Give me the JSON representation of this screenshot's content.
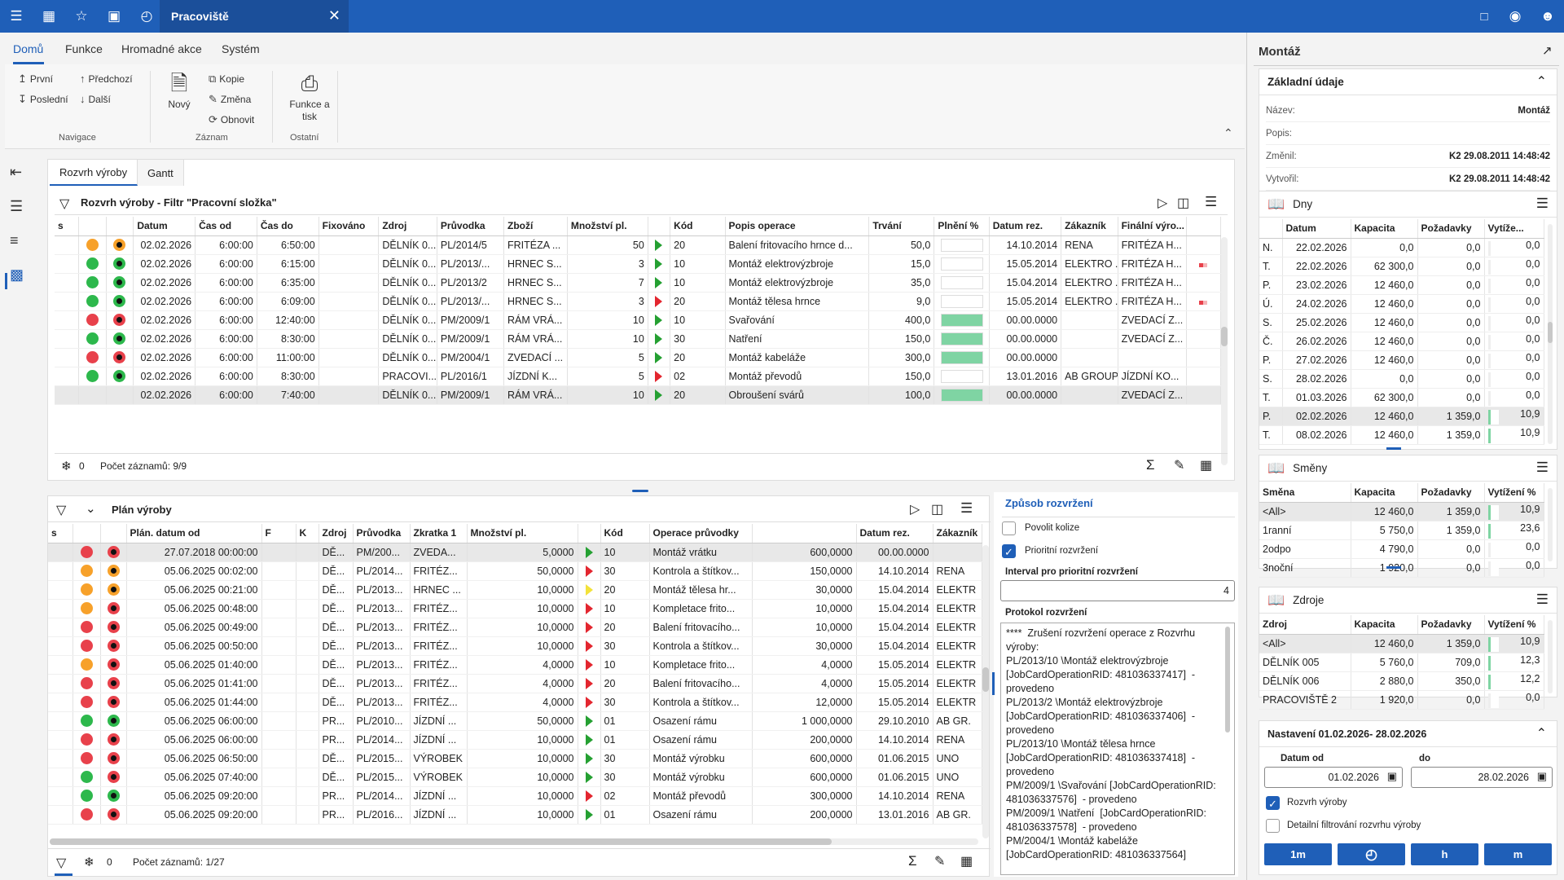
{
  "titlebar": {
    "tab_title": "Pracoviště"
  },
  "menu": [
    "Domů",
    "Funkce",
    "Hromadné akce",
    "Systém"
  ],
  "ribbon": {
    "nav": {
      "first": "První",
      "prev": "Předchozí",
      "last": "Poslední",
      "next": "Další",
      "group": "Navigace"
    },
    "record": {
      "new": "Nový",
      "copy": "Kopie",
      "change": "Změna",
      "refresh": "Obnovit",
      "group": "Záznam"
    },
    "other": {
      "print": "Funkce a tisk",
      "group": "Ostatní"
    }
  },
  "top_panel": {
    "tabs": [
      "Rozvrh výroby",
      "Gantt"
    ],
    "title": "Rozvrh výroby - Filtr \"Pracovní složka\"",
    "columns": [
      "s",
      "",
      "",
      "Datum",
      "Čas od",
      "Čas do",
      "Fixováno",
      "Zdroj",
      "Průvodka",
      "Zboží",
      "Množství pl.",
      "",
      "Kód",
      "Popis operace",
      "Trvání",
      "Plnění %",
      "Datum rez.",
      "Zákazník",
      "Finální výro..."
    ],
    "rows": [
      {
        "s1": "orange",
        "s2": "orange",
        "date": "02.02.2026",
        "from": "6:00:00",
        "to": "6:50:00",
        "fix": "",
        "src": "DĚLNÍK 0...",
        "card": "PL/2014/5",
        "item": "FRITÉZA ...",
        "qty": "50",
        "tri": "green",
        "code": "20",
        "op": "Balení fritovacího hrnce d...",
        "dur": "50,0",
        "fill": 0,
        "dres": "14.10.2014",
        "cust": "RENA",
        "fin": "FRITÉZA H...",
        "flag": false
      },
      {
        "s1": "green",
        "s2": "green",
        "date": "02.02.2026",
        "from": "6:00:00",
        "to": "6:15:00",
        "fix": "",
        "src": "DĚLNÍK 0...",
        "card": "PL/2013/...",
        "item": "HRNEC S...",
        "qty": "3",
        "tri": "green",
        "code": "10",
        "op": "Montáž elektrovýzbroje",
        "dur": "15,0",
        "fill": 0,
        "dres": "15.05.2014",
        "cust": "ELEKTRO ...",
        "fin": "FRITÉZA H...",
        "flag": true
      },
      {
        "s1": "green",
        "s2": "green",
        "date": "02.02.2026",
        "from": "6:00:00",
        "to": "6:35:00",
        "fix": "",
        "src": "DĚLNÍK 0...",
        "card": "PL/2013/2",
        "item": "HRNEC S...",
        "qty": "7",
        "tri": "green",
        "code": "10",
        "op": "Montáž elektrovýzbroje",
        "dur": "35,0",
        "fill": 0,
        "dres": "15.04.2014",
        "cust": "ELEKTRO ...",
        "fin": "FRITÉZA H...",
        "flag": false
      },
      {
        "s1": "green",
        "s2": "green",
        "date": "02.02.2026",
        "from": "6:00:00",
        "to": "6:09:00",
        "fix": "",
        "src": "DĚLNÍK 0...",
        "card": "PL/2013/...",
        "item": "HRNEC S...",
        "qty": "3",
        "tri": "red",
        "code": "20",
        "op": "Montáž tělesa hrnce",
        "dur": "9,0",
        "fill": 0,
        "dres": "15.05.2014",
        "cust": "ELEKTRO ...",
        "fin": "FRITÉZA H...",
        "flag": true
      },
      {
        "s1": "red",
        "s2": "red",
        "date": "02.02.2026",
        "from": "6:00:00",
        "to": "12:40:00",
        "fix": "",
        "src": "DĚLNÍK 0...",
        "card": "PM/2009/1",
        "item": "RÁM VRÁ...",
        "qty": "10",
        "tri": "green",
        "code": "10",
        "op": "Svařování",
        "dur": "400,0",
        "fill": 100,
        "dres": "00.00.0000",
        "cust": "",
        "fin": "ZVEDACÍ Z...",
        "flag": false
      },
      {
        "s1": "green",
        "s2": "green",
        "date": "02.02.2026",
        "from": "6:00:00",
        "to": "8:30:00",
        "fix": "",
        "src": "DĚLNÍK 0...",
        "card": "PM/2009/1",
        "item": "RÁM VRÁ...",
        "qty": "10",
        "tri": "green",
        "code": "30",
        "op": "Natření",
        "dur": "150,0",
        "fill": 100,
        "dres": "00.00.0000",
        "cust": "",
        "fin": "ZVEDACÍ Z...",
        "flag": false
      },
      {
        "s1": "red",
        "s2": "red",
        "date": "02.02.2026",
        "from": "6:00:00",
        "to": "11:00:00",
        "fix": "",
        "src": "DĚLNÍK 0...",
        "card": "PM/2004/1",
        "item": "ZVEDACÍ ...",
        "qty": "5",
        "tri": "green",
        "code": "20",
        "op": "Montáž kabeláže",
        "dur": "300,0",
        "fill": 100,
        "dres": "00.00.0000",
        "cust": "",
        "fin": "",
        "flag": false
      },
      {
        "s1": "green",
        "s2": "green",
        "date": "02.02.2026",
        "from": "6:00:00",
        "to": "8:30:00",
        "fix": "",
        "src": "PRACOVI...",
        "card": "PL/2016/1",
        "item": "JÍZDNÍ K...",
        "qty": "5",
        "tri": "red",
        "code": "02",
        "op": "Montáž převodů",
        "dur": "150,0",
        "fill": 0,
        "dres": "13.01.2016",
        "cust": "AB GROUP",
        "fin": "JÍZDNÍ KO...",
        "flag": false
      },
      {
        "s1": "",
        "s2": "",
        "date": "02.02.2026",
        "from": "6:00:00",
        "to": "7:40:00",
        "fix": "",
        "src": "DĚLNÍK 0...",
        "card": "PM/2009/1",
        "item": "RÁM VRÁ...",
        "qty": "10",
        "tri": "green",
        "code": "20",
        "op": "Obroušení svárů",
        "dur": "100,0",
        "fill": 100,
        "dres": "00.00.0000",
        "cust": "",
        "fin": "ZVEDACÍ Z...",
        "flag": false,
        "selected": true
      }
    ],
    "footer": {
      "count_zero": "0",
      "records": "Počet záznamů: 9/9"
    }
  },
  "bottom_panel": {
    "title": "Plán výroby",
    "columns": [
      "s",
      "",
      "",
      "Plán. datum od",
      "F",
      "K",
      "Zdroj",
      "Průvodka",
      "Zkratka 1",
      "Množství pl.",
      "",
      "Kód",
      "Operace průvodky",
      "",
      "Datum rez.",
      "Zákazník"
    ],
    "rows": [
      {
        "s1": "red",
        "s2": "red",
        "date": "27.07.2018 00:00:00",
        "src": "DĚ...",
        "card": "PM/200...",
        "abbr": "ZVEDA...",
        "qty": "5,0000",
        "tri": "green",
        "code": "10",
        "op": "Montáž vrátku",
        "val": "600,0000",
        "dres": "00.00.0000",
        "cust": "",
        "selected": true
      },
      {
        "s1": "orange",
        "s2": "orange",
        "date": "05.06.2025 00:02:00",
        "src": "DĚ...",
        "card": "PL/2014...",
        "abbr": "FRITÉZ...",
        "qty": "50,0000",
        "tri": "red",
        "code": "30",
        "op": "Kontrola a štítkov...",
        "val": "150,0000",
        "dres": "14.10.2014",
        "cust": "RENA"
      },
      {
        "s1": "orange",
        "s2": "orange",
        "date": "05.06.2025 00:21:00",
        "src": "DĚ...",
        "card": "PL/2013...",
        "abbr": "HRNEC ...",
        "qty": "10,0000",
        "tri": "yellow",
        "code": "20",
        "op": "Montáž tělesa hr...",
        "val": "30,0000",
        "dres": "15.04.2014",
        "cust": "ELEKTR"
      },
      {
        "s1": "orange",
        "s2": "red",
        "date": "05.06.2025 00:48:00",
        "src": "DĚ...",
        "card": "PL/2013...",
        "abbr": "FRITÉZ...",
        "qty": "10,0000",
        "tri": "red",
        "code": "10",
        "op": "Kompletace frito...",
        "val": "10,0000",
        "dres": "15.04.2014",
        "cust": "ELEKTR"
      },
      {
        "s1": "red",
        "s2": "red",
        "date": "05.06.2025 00:49:00",
        "src": "DĚ...",
        "card": "PL/2013...",
        "abbr": "FRITÉZ...",
        "qty": "10,0000",
        "tri": "red",
        "code": "20",
        "op": "Balení fritovacího...",
        "val": "10,0000",
        "dres": "15.04.2014",
        "cust": "ELEKTR"
      },
      {
        "s1": "red",
        "s2": "red",
        "date": "05.06.2025 00:50:00",
        "src": "DĚ...",
        "card": "PL/2013...",
        "abbr": "FRITÉZ...",
        "qty": "10,0000",
        "tri": "red",
        "code": "30",
        "op": "Kontrola a štítkov...",
        "val": "30,0000",
        "dres": "15.04.2014",
        "cust": "ELEKTR"
      },
      {
        "s1": "orange",
        "s2": "red",
        "date": "05.06.2025 01:40:00",
        "src": "DĚ...",
        "card": "PL/2013...",
        "abbr": "FRITÉZ...",
        "qty": "4,0000",
        "tri": "red",
        "code": "10",
        "op": "Kompletace frito...",
        "val": "4,0000",
        "dres": "15.05.2014",
        "cust": "ELEKTR"
      },
      {
        "s1": "red",
        "s2": "red",
        "date": "05.06.2025 01:41:00",
        "src": "DĚ...",
        "card": "PL/2013...",
        "abbr": "FRITÉZ...",
        "qty": "4,0000",
        "tri": "red",
        "code": "20",
        "op": "Balení fritovacího...",
        "val": "4,0000",
        "dres": "15.05.2014",
        "cust": "ELEKTR"
      },
      {
        "s1": "red",
        "s2": "red",
        "date": "05.06.2025 01:44:00",
        "src": "DĚ...",
        "card": "PL/2013...",
        "abbr": "FRITÉZ...",
        "qty": "4,0000",
        "tri": "red",
        "code": "30",
        "op": "Kontrola a štítkov...",
        "val": "12,0000",
        "dres": "15.05.2014",
        "cust": "ELEKTR"
      },
      {
        "s1": "green",
        "s2": "green",
        "date": "05.06.2025 06:00:00",
        "src": "PR...",
        "card": "PL/2010...",
        "abbr": "JÍZDNÍ ...",
        "qty": "50,0000",
        "tri": "green",
        "code": "01",
        "op": "Osazení rámu",
        "val": "1 000,0000",
        "dres": "29.10.2010",
        "cust": "AB GR."
      },
      {
        "s1": "red",
        "s2": "red",
        "date": "05.06.2025 06:00:00",
        "src": "PR...",
        "card": "PL/2014...",
        "abbr": "JÍZDNÍ ...",
        "qty": "10,0000",
        "tri": "green",
        "code": "01",
        "op": "Osazení rámu",
        "val": "200,0000",
        "dres": "14.10.2014",
        "cust": "RENA"
      },
      {
        "s1": "red",
        "s2": "red",
        "date": "05.06.2025 06:50:00",
        "src": "DĚ...",
        "card": "PL/2015...",
        "abbr": "VÝROBEK",
        "qty": "10,0000",
        "tri": "green",
        "code": "30",
        "op": "Montáž výrobku",
        "val": "600,0000",
        "dres": "01.06.2015",
        "cust": "UNO"
      },
      {
        "s1": "green",
        "s2": "red",
        "date": "05.06.2025 07:40:00",
        "src": "DĚ...",
        "card": "PL/2015...",
        "abbr": "VÝROBEK",
        "qty": "10,0000",
        "tri": "green",
        "code": "30",
        "op": "Montáž výrobku",
        "val": "600,0000",
        "dres": "01.06.2015",
        "cust": "UNO"
      },
      {
        "s1": "green",
        "s2": "green",
        "date": "05.06.2025 09:20:00",
        "src": "PR...",
        "card": "PL/2014...",
        "abbr": "JÍZDNÍ ...",
        "qty": "10,0000",
        "tri": "red",
        "code": "02",
        "op": "Montáž převodů",
        "val": "300,0000",
        "dres": "14.10.2014",
        "cust": "RENA"
      },
      {
        "s1": "red",
        "s2": "red",
        "date": "05.06.2025 09:20:00",
        "src": "PR...",
        "card": "PL/2016...",
        "abbr": "JÍZDNÍ ...",
        "qty": "10,0000",
        "tri": "green",
        "code": "01",
        "op": "Osazení rámu",
        "val": "200,0000",
        "dres": "13.01.2016",
        "cust": "AB GR."
      }
    ],
    "footer": {
      "count_zero": "0",
      "records": "Počet záznamů: 1/27"
    }
  },
  "scheduling": {
    "title": "Způsob rozvržení",
    "allow_collision": "Povolit kolize",
    "priority": "Prioritní rozvržení",
    "interval_label": "Interval pro prioritní rozvržení",
    "interval_value": "4",
    "protocol_label": "Protokol rozvržení",
    "protocol_text": "****  Zrušení rozvržení operace z Rozvrhu výroby:\nPL/2013/10 \\Montáž elektrovýzbroje [JobCardOperationRID: 481036337417]  - provedeno\nPL/2013/2 \\Montáž elektrovýzbroje [JobCardOperationRID: 481036337406]  - provedeno\nPL/2013/10 \\Montáž tělesa hrnce [JobCardOperationRID: 481036337418]  - provedeno\nPM/2009/1 \\Svařování [JobCardOperationRID: 481036337576]  - provedeno\nPM/2009/1 \\Natření  [JobCardOperationRID: 481036337578]  - provedeno\nPM/2004/1 \\Montáž kabeláže [JobCardOperationRID: 481036337564]"
  },
  "right": {
    "title": "Montáž",
    "basic": {
      "header": "Základní údaje",
      "rows": [
        {
          "k": "Název:",
          "v": "Montáž"
        },
        {
          "k": "Popis:",
          "v": ""
        },
        {
          "k": "Změnil:",
          "v": "K2 29.08.2011 14:48:42"
        },
        {
          "k": "Vytvořil:",
          "v": "K2 29.08.2011 14:48:42"
        }
      ]
    },
    "days": {
      "header": "Dny",
      "columns": [
        "",
        "Datum",
        "Kapacita",
        "Požadavky",
        "Vytíže..."
      ],
      "rows": [
        [
          "N.",
          "22.02.2026",
          "0,0",
          "0,0",
          "0,0"
        ],
        [
          "T.",
          "22.02.2026",
          "62 300,0",
          "0,0",
          "0,0"
        ],
        [
          "P.",
          "23.02.2026",
          "12 460,0",
          "0,0",
          "0,0"
        ],
        [
          "Ú.",
          "24.02.2026",
          "12 460,0",
          "0,0",
          "0,0"
        ],
        [
          "S.",
          "25.02.2026",
          "12 460,0",
          "0,0",
          "0,0"
        ],
        [
          "Č.",
          "26.02.2026",
          "12 460,0",
          "0,0",
          "0,0"
        ],
        [
          "P.",
          "27.02.2026",
          "12 460,0",
          "0,0",
          "0,0"
        ],
        [
          "S.",
          "28.02.2026",
          "0,0",
          "0,0",
          "0,0"
        ],
        [
          "T.",
          "01.03.2026",
          "62 300,0",
          "0,0",
          "0,0"
        ],
        [
          "P.",
          "02.02.2026",
          "12 460,0",
          "1 359,0",
          "10,9"
        ],
        [
          "T.",
          "08.02.2026",
          "12 460,0",
          "1 359,0",
          "10,9"
        ]
      ]
    },
    "shifts": {
      "header": "Směny",
      "columns": [
        "Směna",
        "Kapacita",
        "Požadavky",
        "Vytížení %"
      ],
      "rows": [
        [
          "<All>",
          "12 460,0",
          "1 359,0",
          "10,9"
        ],
        [
          "1ranní",
          "5 750,0",
          "1 359,0",
          "23,6"
        ],
        [
          "2odpo",
          "4 790,0",
          "0,0",
          "0,0"
        ],
        [
          "3noční",
          "1 920,0",
          "0,0",
          "0,0"
        ]
      ]
    },
    "resources": {
      "header": "Zdroje",
      "columns": [
        "Zdroj",
        "Kapacita",
        "Požadavky",
        "Vytížení %"
      ],
      "rows": [
        [
          "<All>",
          "12 460,0",
          "1 359,0",
          "10,9"
        ],
        [
          "DĚLNÍK 005",
          "5 760,0",
          "709,0",
          "12,3"
        ],
        [
          "DĚLNÍK 006",
          "2 880,0",
          "350,0",
          "12,2"
        ],
        [
          "PRACOVIŠTĚ 2",
          "1 920,0",
          "0,0",
          "0,0"
        ]
      ]
    },
    "settings": {
      "header": "Nastavení 01.02.2026- 28.02.2026",
      "from_label": "Datum od",
      "to_label": "do",
      "from": "01.02.2026",
      "to": "28.02.2026",
      "schedule": "Rozvrh výroby",
      "detail_filter": "Detailní filtrování rozvrhu výroby",
      "buttons": [
        "1m",
        "",
        "h",
        "m"
      ]
    }
  }
}
